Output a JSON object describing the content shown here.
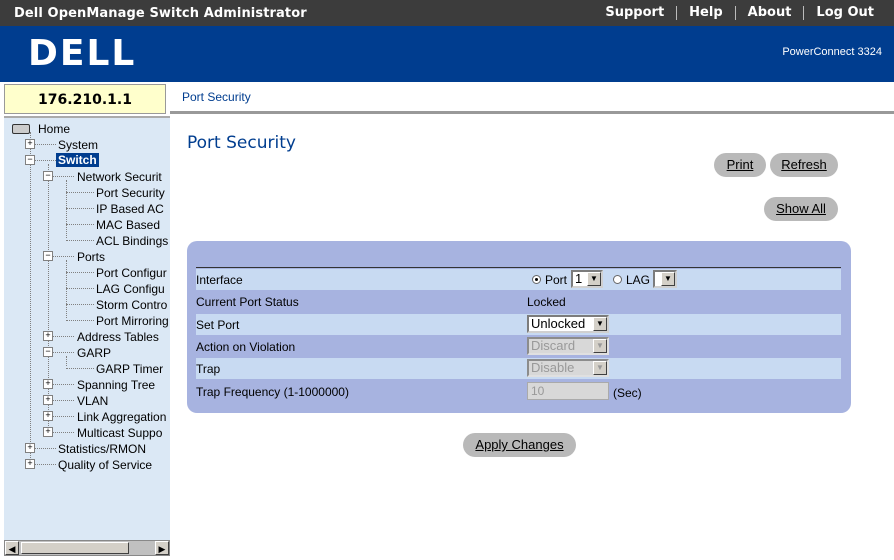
{
  "app": {
    "title": "Dell OpenManage Switch Administrator",
    "menu": [
      "Support",
      "Help",
      "About",
      "Log Out"
    ],
    "logo": "DELL",
    "model": "PowerConnect 3324",
    "ip_address": "176.210.1.1"
  },
  "breadcrumb": "Port Security",
  "sidebar": {
    "home": "Home",
    "items": {
      "system": "System",
      "switch": "Switch",
      "network_security": "Network Securit",
      "port_security": "Port Security",
      "ip_based_acl": "IP Based AC",
      "mac_based": "MAC Based",
      "acl_bindings": "ACL Bindings",
      "ports": "Ports",
      "port_configuration": "Port Configur",
      "lag_configuration": "LAG Configu",
      "storm_control": "Storm Contro",
      "port_mirroring": "Port Mirroring",
      "address_tables": "Address Tables",
      "garp": "GARP",
      "garp_timers": "GARP Timer",
      "spanning_tree": "Spanning Tree",
      "vlan": "VLAN",
      "link_aggregation": "Link Aggregation",
      "multicast_support": "Multicast Suppo",
      "statistics_rmon": "Statistics/RMON",
      "quality_of_service": "Quality of Service"
    }
  },
  "main": {
    "page_title": "Port Security",
    "buttons": {
      "print": "Print",
      "refresh": "Refresh",
      "show_all": "Show All",
      "apply_changes": "Apply Changes"
    },
    "form": {
      "interface_label": "Interface",
      "port_option": "Port",
      "port_value": "1",
      "lag_option": "LAG",
      "lag_value": "",
      "interface_selected": "Port",
      "current_port_status_label": "Current Port Status",
      "current_port_status_value": "Locked",
      "set_port_label": "Set Port",
      "set_port_value": "Unlocked",
      "action_label": "Action on Violation",
      "action_value": "Discard",
      "trap_label": "Trap",
      "trap_value": "Disable",
      "trap_frequency_label": "Trap Frequency (1-1000000)",
      "trap_frequency_value": "10",
      "trap_frequency_unit": "(Sec)"
    }
  },
  "colors": {
    "header_blue": "#003d8f",
    "topbar": "#3c3c3c",
    "sidebar_bg": "#dbe8f5",
    "panel": "#a7b3e0",
    "row_shade": "#c8daf2",
    "button": "#b9b9b9"
  }
}
